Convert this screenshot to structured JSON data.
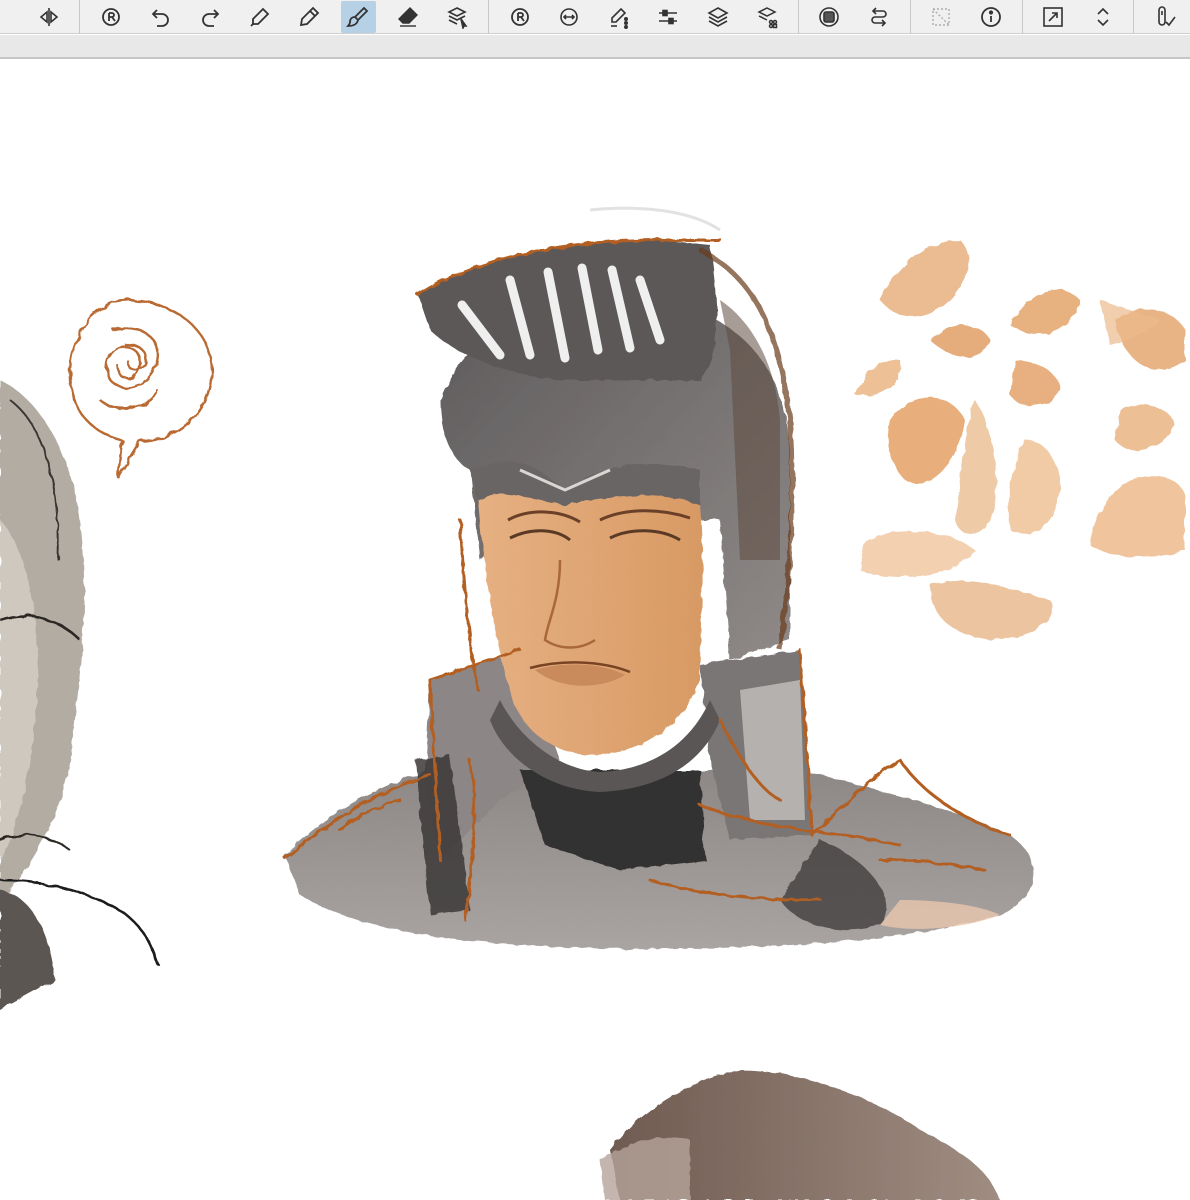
{
  "toolbar": {
    "groups": [
      [
        "flip-horizontal-icon"
      ],
      [
        "rotate-reset-icon",
        "undo-icon",
        "redo-icon",
        "pen-tool-icon",
        "pencil-tool-icon",
        "brush-tool-icon",
        "eraser-tool-icon",
        "layer-select-icon"
      ],
      [
        "zoom-reset-icon",
        "transform-icon",
        "vector-pen-icon",
        "adjust-sliders-icon",
        "layers-icon",
        "layer-palette-icon"
      ],
      [
        "tone-icon",
        "swap-icon"
      ],
      [
        "selection-disabled-icon",
        "info-icon"
      ],
      [
        "resize-canvas-icon",
        "chevron-updown-icon"
      ],
      [
        "pen-pressure-icon"
      ]
    ],
    "active_tool": "brush-tool-icon"
  },
  "colors": {
    "toolbar_bg": "#f0f0f0",
    "active_tool_bg": "#b6d0e6",
    "canvas_bg": "#ffffff",
    "sketch_line": "#b35f22",
    "armor_gray": "#6e6b6a",
    "skin_tone": "#e2a874"
  }
}
